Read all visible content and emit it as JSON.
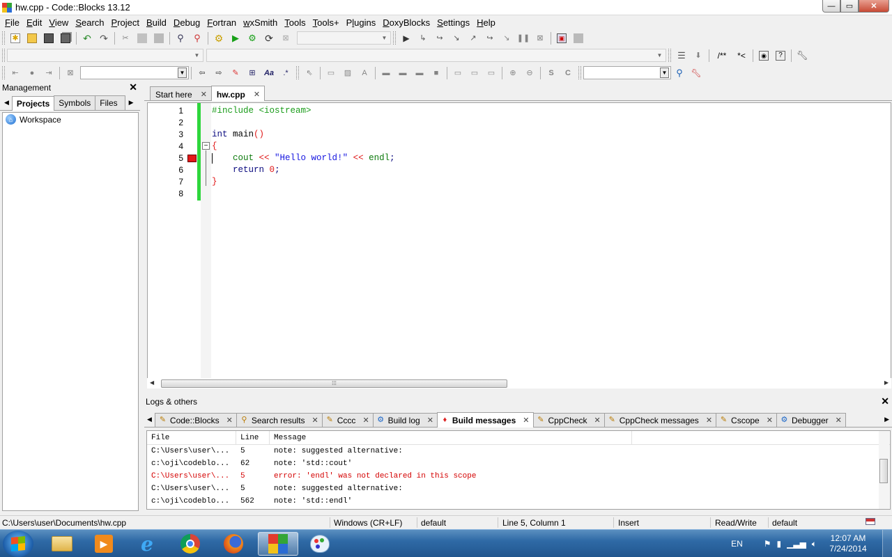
{
  "window": {
    "title": "hw.cpp - Code::Blocks 13.12",
    "min": "—",
    "max": "▭",
    "close": "✕"
  },
  "menu": [
    "File",
    "Edit",
    "View",
    "Search",
    "Project",
    "Build",
    "Debug",
    "Fortran",
    "wxSmith",
    "Tools",
    "Tools+",
    "Plugins",
    "DoxyBlocks",
    "Settings",
    "Help"
  ],
  "menu_mnemonics": [
    "F",
    "E",
    "V",
    "S",
    "P",
    "B",
    "D",
    "F",
    "w",
    "T",
    "T",
    "l",
    "D",
    "S",
    "H"
  ],
  "toolbar": {
    "build_target_value": "",
    "scope_value": "",
    "function_value": "",
    "search_value": "",
    "find_value": "",
    "doxy_comment": "/**",
    "doxy_inline": "*<"
  },
  "management": {
    "title": "Management",
    "tabs": [
      "Projects",
      "Symbols",
      "Files"
    ],
    "active_tab": "Projects",
    "workspace_label": "Workspace"
  },
  "editor": {
    "tabs": [
      {
        "label": "Start here",
        "active": false
      },
      {
        "label": "hw.cpp",
        "active": true
      }
    ],
    "lines": [
      {
        "n": "1",
        "code": [
          {
            "t": "#include <iostream>",
            "c": "c-pre"
          }
        ]
      },
      {
        "n": "2",
        "code": []
      },
      {
        "n": "3",
        "code": [
          {
            "t": "int",
            "c": "c-kw"
          },
          {
            "t": " main",
            "c": ""
          },
          {
            "t": "()",
            "c": "c-op"
          }
        ]
      },
      {
        "n": "4",
        "code": [
          {
            "t": "{",
            "c": "c-op"
          }
        ]
      },
      {
        "n": "5",
        "code": [
          {
            "t": "    ",
            "c": ""
          },
          {
            "t": "cout",
            "c": "c-id"
          },
          {
            "t": " << ",
            "c": "c-op"
          },
          {
            "t": "\"Hello world!\"",
            "c": "c-str"
          },
          {
            "t": " << ",
            "c": "c-op"
          },
          {
            "t": "endl",
            "c": "c-id"
          },
          {
            "t": ";",
            "c": "c-kw"
          }
        ]
      },
      {
        "n": "6",
        "code": [
          {
            "t": "    ",
            "c": ""
          },
          {
            "t": "return",
            "c": "c-kw"
          },
          {
            "t": " ",
            "c": ""
          },
          {
            "t": "0",
            "c": "c-num"
          },
          {
            "t": ";",
            "c": "c-kw"
          }
        ]
      },
      {
        "n": "7",
        "code": [
          {
            "t": "}",
            "c": "c-op"
          }
        ]
      },
      {
        "n": "8",
        "code": []
      }
    ],
    "breakpoint_line": 5
  },
  "logs": {
    "title": "Logs & others",
    "tabs": [
      {
        "label": "Code::Blocks",
        "icon": "✎",
        "active": false
      },
      {
        "label": "Search results",
        "icon": "⚲",
        "active": false
      },
      {
        "label": "Cccc",
        "icon": "✎",
        "active": false
      },
      {
        "label": "Build log",
        "icon": "⚙",
        "active": false
      },
      {
        "label": "Build messages",
        "icon": "♦",
        "active": true
      },
      {
        "label": "CppCheck",
        "icon": "✎",
        "active": false
      },
      {
        "label": "CppCheck messages",
        "icon": "✎",
        "active": false
      },
      {
        "label": "Cscope",
        "icon": "✎",
        "active": false
      },
      {
        "label": "Debugger",
        "icon": "⚙",
        "active": false
      }
    ],
    "columns": [
      "File",
      "Line",
      "Message"
    ],
    "rows": [
      {
        "file": "C:\\Users\\user\\...",
        "line": "5",
        "message": "note: suggested alternative:",
        "error": false
      },
      {
        "file": "c:\\oji\\codeblo...",
        "line": "62",
        "message": "note:   'std::cout'",
        "error": false
      },
      {
        "file": "C:\\Users\\user\\...",
        "line": "5",
        "message": "error: 'endl' was not declared in this scope",
        "error": true
      },
      {
        "file": "C:\\Users\\user\\...",
        "line": "5",
        "message": "note: suggested alternative:",
        "error": false
      },
      {
        "file": "c:\\oji\\codeblo...",
        "line": "562",
        "message": "note:   'std::endl'",
        "error": false
      }
    ]
  },
  "status": {
    "path": "C:\\Users\\user\\Documents\\hw.cpp",
    "eol": "Windows (CR+LF)",
    "encoding": "default",
    "position": "Line 5, Column 1",
    "mode": "Insert",
    "access": "Read/Write",
    "lexer": "default"
  },
  "taskbar": {
    "language": "EN",
    "time": "12:07 AM",
    "date": "7/24/2014"
  },
  "colors": {
    "breakpoint": "#e21818",
    "change_margin": "#2ed63c",
    "error_text": "#d40000"
  }
}
